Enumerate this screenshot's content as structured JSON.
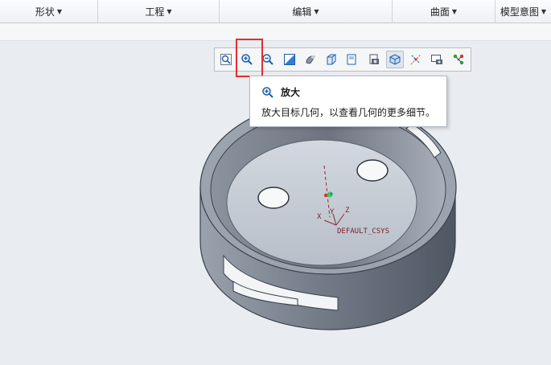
{
  "ribbon": {
    "groups": [
      {
        "label": "形状"
      },
      {
        "label": "工程"
      },
      {
        "label": "编辑"
      },
      {
        "label": "曲面"
      },
      {
        "label": "模型意图"
      }
    ]
  },
  "view_toolbar": {
    "buttons": [
      {
        "icon": "refit-icon",
        "active": false
      },
      {
        "icon": "zoom-in-icon",
        "active": false,
        "highlighted": true
      },
      {
        "icon": "zoom-out-icon",
        "active": false
      },
      {
        "icon": "repaint-icon",
        "active": false
      },
      {
        "icon": "display-style-icon",
        "active": false
      },
      {
        "icon": "saved-orientations-icon",
        "active": false
      },
      {
        "icon": "view-manager-icon",
        "active": false
      },
      {
        "icon": "perspective-view-icon",
        "active": false
      },
      {
        "icon": "appearance-icon",
        "active": true
      },
      {
        "icon": "datum-display-icon",
        "active": false
      },
      {
        "icon": "annotation-display-icon",
        "active": false
      },
      {
        "icon": "spin-center-icon",
        "active": false
      }
    ]
  },
  "tooltip": {
    "title": "放大",
    "description": "放大目标几何，以查看几何的更多细节。"
  },
  "model": {
    "csys_label": "DEFAULT_CSYS",
    "axis_x": "X",
    "axis_y": "Y",
    "axis_z": "Z"
  },
  "colors": {
    "highlight_box": "#e03030",
    "model_body": "#7f8894",
    "model_floor": "#c9cfd8",
    "csys_label": "#7a1f2a"
  }
}
